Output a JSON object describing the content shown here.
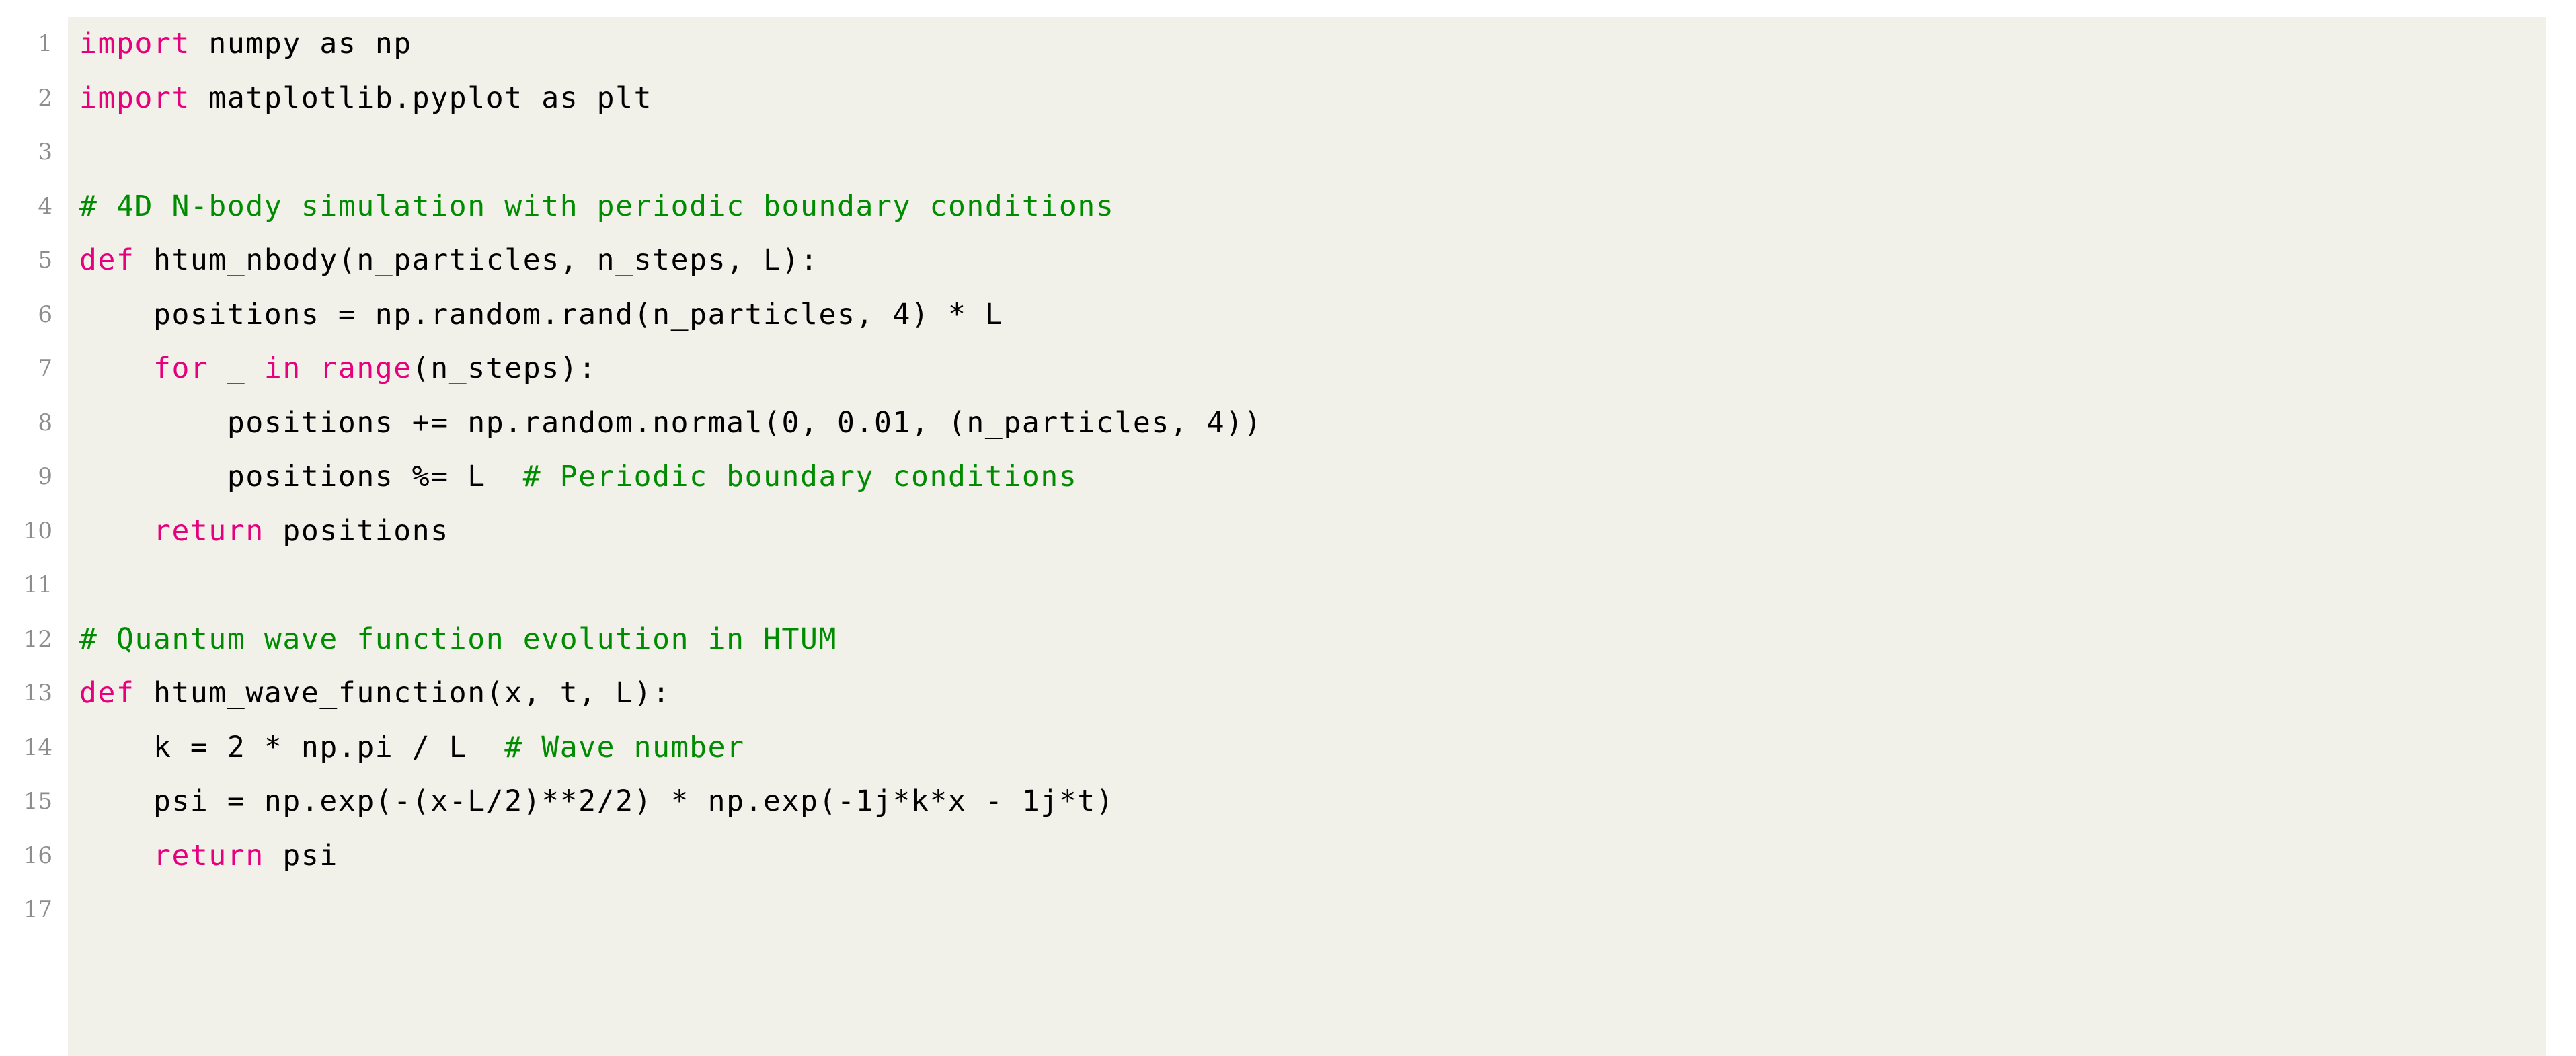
{
  "document": {
    "kind": "code-listing",
    "language": "Python",
    "background_color": "#f1f0e9",
    "page_color": "#ffffff",
    "line_number_color": "#8d8d8d",
    "colors": {
      "keyword": "#e6007e",
      "comment": "#008c00",
      "text": "#000000"
    },
    "line_count": 17
  },
  "lines": [
    {
      "number": "1",
      "tokens": [
        {
          "text": "import",
          "type": "kw"
        },
        {
          "text": " numpy as np",
          "type": "txt"
        }
      ]
    },
    {
      "number": "2",
      "tokens": [
        {
          "text": "import",
          "type": "kw"
        },
        {
          "text": " matplotlib.pyplot as plt",
          "type": "txt"
        }
      ]
    },
    {
      "number": "3",
      "tokens": []
    },
    {
      "number": "4",
      "tokens": [
        {
          "text": "# 4D N-body simulation with periodic boundary conditions",
          "type": "cmt"
        }
      ]
    },
    {
      "number": "5",
      "tokens": [
        {
          "text": "def",
          "type": "kw"
        },
        {
          "text": " htum_nbody(n_particles, n_steps, L):",
          "type": "txt"
        }
      ]
    },
    {
      "number": "6",
      "tokens": [
        {
          "text": "    positions = np.random.rand(n_particles, 4) * L",
          "type": "txt"
        }
      ]
    },
    {
      "number": "7",
      "tokens": [
        {
          "text": "    ",
          "type": "txt"
        },
        {
          "text": "for",
          "type": "kw"
        },
        {
          "text": " _ ",
          "type": "txt"
        },
        {
          "text": "in range",
          "type": "kw"
        },
        {
          "text": "(n_steps):",
          "type": "txt"
        }
      ]
    },
    {
      "number": "8",
      "tokens": [
        {
          "text": "        positions += np.random.normal(0, 0.01, (n_particles, 4))",
          "type": "txt"
        }
      ]
    },
    {
      "number": "9",
      "tokens": [
        {
          "text": "        positions %= L  ",
          "type": "txt"
        },
        {
          "text": "# Periodic boundary conditions",
          "type": "cmt"
        }
      ]
    },
    {
      "number": "10",
      "tokens": [
        {
          "text": "    ",
          "type": "txt"
        },
        {
          "text": "return",
          "type": "kw"
        },
        {
          "text": " positions",
          "type": "txt"
        }
      ]
    },
    {
      "number": "11",
      "tokens": []
    },
    {
      "number": "12",
      "tokens": [
        {
          "text": "# Quantum wave function evolution in HTUM",
          "type": "cmt"
        }
      ]
    },
    {
      "number": "13",
      "tokens": [
        {
          "text": "def",
          "type": "kw"
        },
        {
          "text": " htum_wave_function(x, t, L):",
          "type": "txt"
        }
      ]
    },
    {
      "number": "14",
      "tokens": [
        {
          "text": "    k = 2 * np.pi / L  ",
          "type": "txt"
        },
        {
          "text": "# Wave number",
          "type": "cmt"
        }
      ]
    },
    {
      "number": "15",
      "tokens": [
        {
          "text": "    psi = np.exp(-(x-L/2)**2/2) * np.exp(-1j*k*x - 1j*t)",
          "type": "txt"
        }
      ]
    },
    {
      "number": "16",
      "tokens": [
        {
          "text": "    ",
          "type": "txt"
        },
        {
          "text": "return",
          "type": "kw"
        },
        {
          "text": " psi",
          "type": "txt"
        }
      ]
    },
    {
      "number": "17",
      "tokens": []
    }
  ]
}
